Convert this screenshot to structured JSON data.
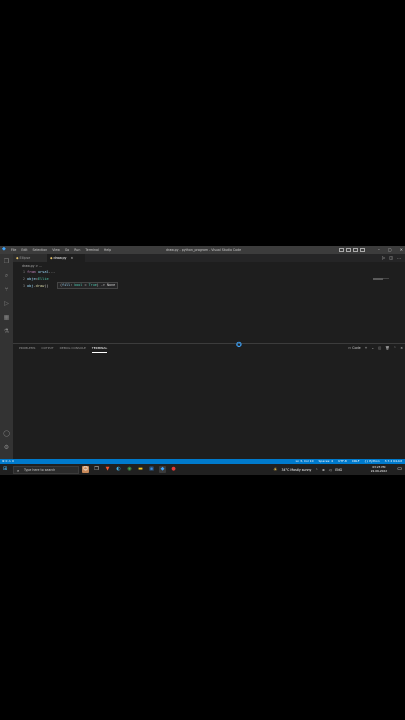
{
  "window": {
    "title": "draw.py - python_program - Visual Studio Code",
    "menu": [
      "File",
      "Edit",
      "Selection",
      "View",
      "Go",
      "Run",
      "Terminal",
      "Help"
    ]
  },
  "tabs": [
    {
      "label": "Ellipse",
      "active": false
    },
    {
      "label": "draw.py",
      "active": true
    }
  ],
  "breadcrumb": "draw.py > ...",
  "code": {
    "lines": [
      {
        "num": "1",
        "kw": "from",
        "mod": "ursal",
        "rest": " ... "
      },
      {
        "num": "2",
        "a": "obje",
        "b": " = ",
        "c": "Ellie"
      },
      {
        "num": "3",
        "a": "obj",
        "b": ".",
        "c": "draw",
        "d": "()"
      }
    ],
    "tooltip": {
      "open": "(",
      "param": "fill",
      "sep": ": ",
      "type": "bool",
      "eq": " = ",
      "val": "True",
      "close": ") -> None"
    }
  },
  "panel": {
    "tabs": [
      "PROBLEMS",
      "OUTPUT",
      "DEBUG CONSOLE",
      "TERMINAL"
    ],
    "active_tab": "TERMINAL",
    "terminal_label": "Code"
  },
  "statusbar": {
    "left": "⊗ 0 ⚠ 0",
    "items": [
      "Ln 3, Col 10",
      "Spaces: 4",
      "UTF-8",
      "CRLF",
      "{} Python",
      "3.7.2 64-bit"
    ]
  },
  "taskbar": {
    "search_placeholder": "Type here to search",
    "weather": "34°C  Mostly sunny",
    "lang": "ENG",
    "time": "03:23 PM",
    "date": "22-06-2022"
  },
  "colors": {
    "accent": "#007acc",
    "editor_bg": "#1e1e1e",
    "activity_bg": "#333333",
    "taskbar_bg": "#202020"
  }
}
